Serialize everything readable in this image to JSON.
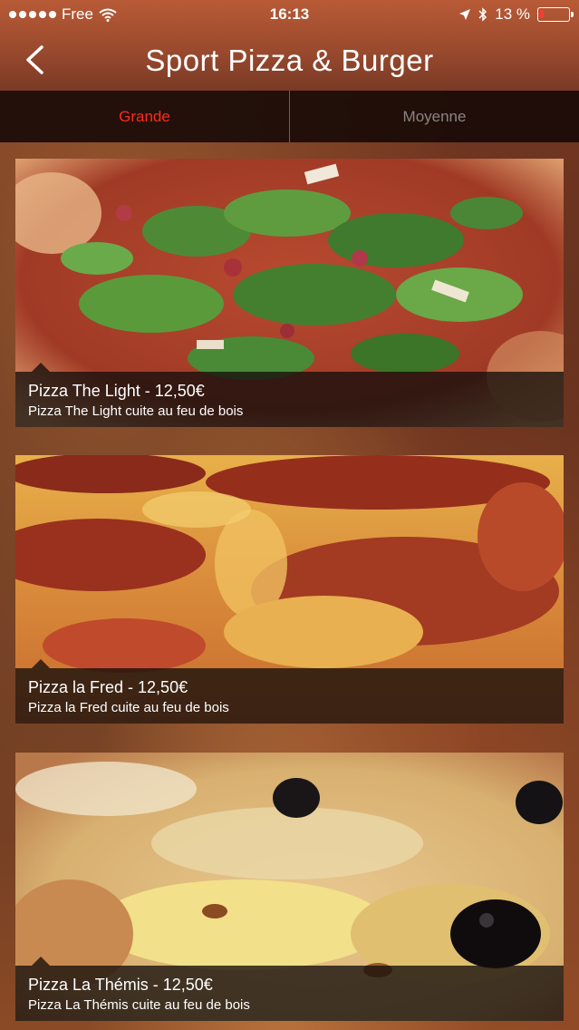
{
  "status_bar": {
    "carrier": "Free",
    "time": "16:13",
    "battery_text": "13 %",
    "battery_level": 0.13
  },
  "nav": {
    "title": "Sport Pizza & Burger",
    "back_icon": "chevron-left-icon"
  },
  "tabs": [
    {
      "label": "Grande",
      "active": true
    },
    {
      "label": "Moyenne",
      "active": false
    }
  ],
  "items": [
    {
      "title": "Pizza The Light - 12,50€",
      "subtitle": "Pizza The Light cuite au feu de bois",
      "image": "pizza-rocket-ham-photo"
    },
    {
      "title": "Pizza la Fred - 12,50€",
      "subtitle": "Pizza la Fred cuite au feu de bois",
      "image": "pizza-chorizo-cheese-photo"
    },
    {
      "title": "Pizza La Thémis - 12,50€",
      "subtitle": "Pizza La Thémis cuite au feu de bois",
      "image": "pizza-cheese-olives-photo"
    }
  ],
  "colors": {
    "header": "#9a4a2e",
    "tab_active": "#ff2a1a",
    "tab_inactive": "#8a8482",
    "battery_low": "#ff3b30"
  }
}
